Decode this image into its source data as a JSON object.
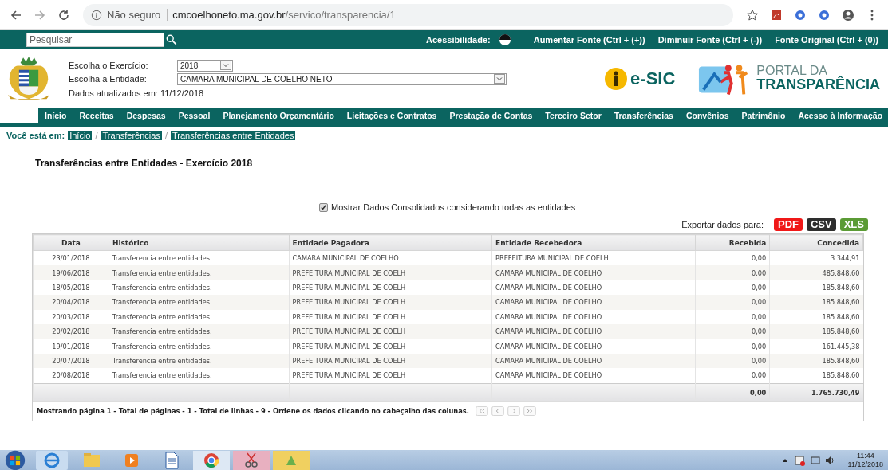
{
  "browser": {
    "security": "Não seguro",
    "url_host": "cmcoelhoneto.ma.gov.br",
    "url_path": "/servico/transparencia/1"
  },
  "topbar": {
    "search": {
      "placeholder": "Pesquisar"
    },
    "accessibility_label": "Acessibilidade:",
    "links": [
      "Aumentar Fonte (Ctrl + (+))",
      "Diminuir Fonte (Ctrl + (-))",
      "Fonte Original (Ctrl + (0))"
    ]
  },
  "header": {
    "fields": [
      {
        "label": "Escolha o Exercício:",
        "value": "2018",
        "kind": "short"
      },
      {
        "label": "Escolha a Entidade:",
        "value": "CAMARA MUNICIPAL DE COELHO NETO",
        "kind": "wide"
      }
    ],
    "updated": "Dados atualizados em: 11/12/2018",
    "esic": "e-SIC",
    "portal": [
      "PORTAL DA",
      "TRANSPARÊNCIA"
    ]
  },
  "nav": [
    "Início",
    "Receitas",
    "Despesas",
    "Pessoal",
    "Planejamento Orçamentário",
    "Licitações e Contratos",
    "Prestação de Contas",
    "Terceiro Setor",
    "Transferências",
    "Convênios",
    "Patrimônio",
    "Acesso à Informação"
  ],
  "breadcrumb": {
    "label": "Você está em:",
    "separator": "/",
    "items": [
      "Início",
      "Transferências",
      "Transferências entre Entidades"
    ]
  },
  "title": "Transferências entre Entidades - Exercício 2018",
  "consolidated": {
    "label": "Mostrar Dados Consolidados considerando todas as entidades",
    "checked": true
  },
  "export": {
    "label": "Exportar dados para:",
    "formats": [
      {
        "label": "PDF",
        "color": "#f01818"
      },
      {
        "label": "CSV",
        "color": "#2e2e2e"
      },
      {
        "label": "XLS",
        "color": "#5b9b35"
      }
    ]
  },
  "table": {
    "columns": [
      {
        "label": "Data",
        "kind": "date"
      },
      {
        "label": "Histórico",
        "kind": "text"
      },
      {
        "label": "Entidade Pagadora",
        "kind": "text"
      },
      {
        "label": "Entidade Recebedora",
        "kind": "text"
      },
      {
        "label": "Recebida",
        "kind": "money"
      },
      {
        "label": "Concedida",
        "kind": "money"
      }
    ],
    "rows": [
      [
        "23/01/2018",
        "Transferencia entre entidades.",
        "CAMARA MUNICIPAL DE COELHO",
        "PREFEITURA MUNICIPAL DE COELH",
        "0,00",
        "3.344,91"
      ],
      [
        "19/06/2018",
        "Transferencia entre entidades.",
        "PREFEITURA MUNICIPAL DE COELH",
        "CAMARA MUNICIPAL DE COELHO",
        "0,00",
        "485.848,60"
      ],
      [
        "18/05/2018",
        "Transferencia entre entidades.",
        "PREFEITURA MUNICIPAL DE COELH",
        "CAMARA MUNICIPAL DE COELHO",
        "0,00",
        "185.848,60"
      ],
      [
        "20/04/2018",
        "Transferencia entre entidades.",
        "PREFEITURA MUNICIPAL DE COELH",
        "CAMARA MUNICIPAL DE COELHO",
        "0,00",
        "185.848,60"
      ],
      [
        "20/03/2018",
        "Transferencia entre entidades.",
        "PREFEITURA MUNICIPAL DE COELH",
        "CAMARA MUNICIPAL DE COELHO",
        "0,00",
        "185.848,60"
      ],
      [
        "20/02/2018",
        "Transferencia entre entidades.",
        "PREFEITURA MUNICIPAL DE COELH",
        "CAMARA MUNICIPAL DE COELHO",
        "0,00",
        "185.848,60"
      ],
      [
        "19/01/2018",
        "Transferencia entre entidades.",
        "PREFEITURA MUNICIPAL DE COELH",
        "CAMARA MUNICIPAL DE COELHO",
        "0,00",
        "161.445,38"
      ],
      [
        "20/07/2018",
        "Transferencia entre entidades.",
        "PREFEITURA MUNICIPAL DE COELH",
        "CAMARA MUNICIPAL DE COELHO",
        "0,00",
        "185.848,60"
      ],
      [
        "20/08/2018",
        "Transferencia entre entidades.",
        "PREFEITURA MUNICIPAL DE COELH",
        "CAMARA MUNICIPAL DE COELHO",
        "0,00",
        "185.848,60"
      ]
    ],
    "totals": [
      "0,00",
      "1.765.730,49"
    ],
    "footer": "Mostrando página 1 - Total de páginas - 1 - Total de linhas - 9 - Ordene os dados clicando no cabeçalho das colunas."
  },
  "taskbar": {
    "time": "11:44",
    "date": "11/12/2018"
  }
}
